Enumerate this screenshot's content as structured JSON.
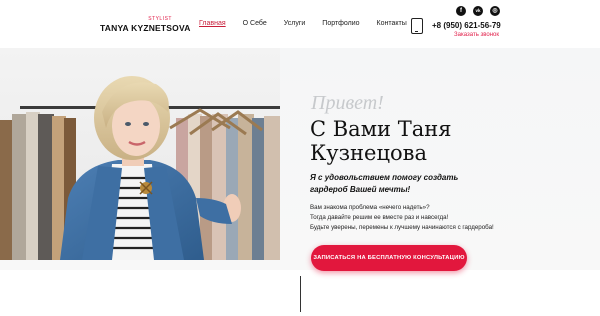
{
  "header": {
    "logo_tag": "STYLIST",
    "logo_name": "TANYA KYZNETSOVA",
    "nav": [
      {
        "label": "Главная"
      },
      {
        "label": "О Себе"
      },
      {
        "label": "Услуги"
      },
      {
        "label": "Портфолио"
      },
      {
        "label": "Контакты"
      }
    ],
    "social": [
      {
        "icon": "facebook-icon",
        "glyph": "f"
      },
      {
        "icon": "vk-icon",
        "glyph": "vk"
      },
      {
        "icon": "instagram-icon",
        "glyph": "◎"
      }
    ],
    "phone": "+8 (950) 621-56-79",
    "callback_label": "Заказать звонок"
  },
  "hero": {
    "greeting": "Привет!",
    "headline_line1": "С Вами Таня",
    "headline_line2": "Кузнецова",
    "tagline_line1": "Я с удовольствием помогу создать",
    "tagline_line2": "гардероб Вашей мечты!",
    "desc_lines": [
      "Вам знакома проблема «нечего надеть»?",
      "Тогда давайте решим ее вместе раз и навсегда!",
      "Будьте уверены, перемены к лучшему начинаются с гардероба!"
    ],
    "cta_label": "ЗАПИСАТЬСЯ НА БЕСПЛАТНУЮ КОНСУЛЬТАЦИЮ"
  },
  "colors": {
    "accent": "#e2173d",
    "nav_active": "#c81e3a",
    "greeting": "#c7c9cc"
  }
}
